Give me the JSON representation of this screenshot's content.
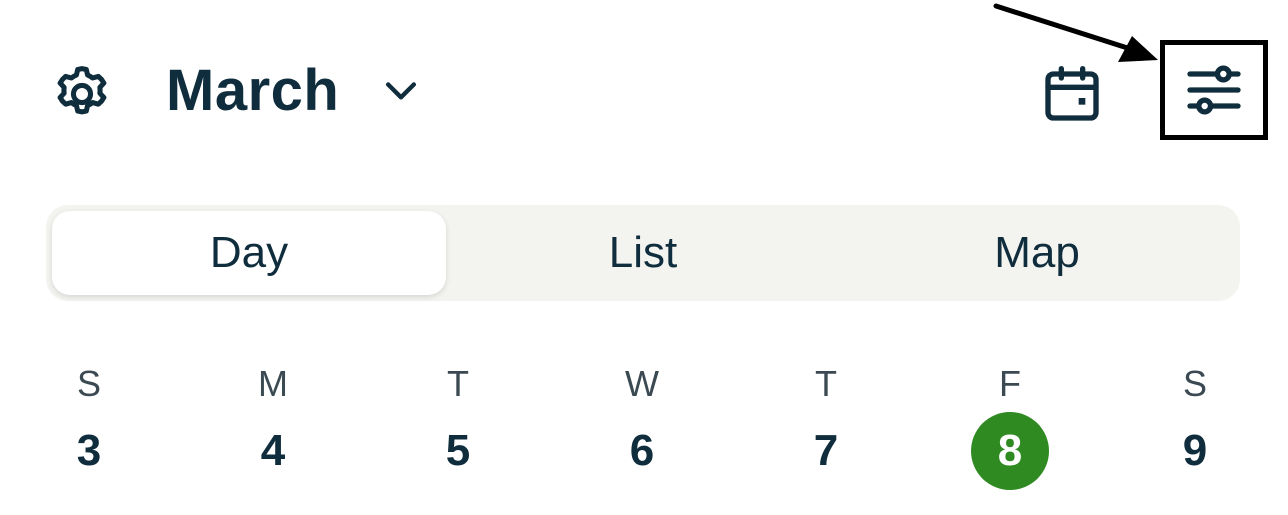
{
  "header": {
    "month_title": "March",
    "settings_icon": "gear-icon",
    "month_dropdown_icon": "chevron-down-icon",
    "calendar_icon": "calendar-icon",
    "filter_icon": "sliders-icon"
  },
  "view_tabs": [
    {
      "label": "Day",
      "active": true
    },
    {
      "label": "List",
      "active": false
    },
    {
      "label": "Map",
      "active": false
    }
  ],
  "week": [
    {
      "dow": "S",
      "date": "3"
    },
    {
      "dow": "M",
      "date": "4"
    },
    {
      "dow": "T",
      "date": "5"
    },
    {
      "dow": "W",
      "date": "6"
    },
    {
      "dow": "T",
      "date": "7"
    },
    {
      "dow": "F",
      "date": "8",
      "selected": true
    },
    {
      "dow": "S",
      "date": "9"
    }
  ],
  "colors": {
    "text": "#0f2d3c",
    "selected_day": "#2f8a22",
    "segmented_bg": "#f3f3f0"
  }
}
